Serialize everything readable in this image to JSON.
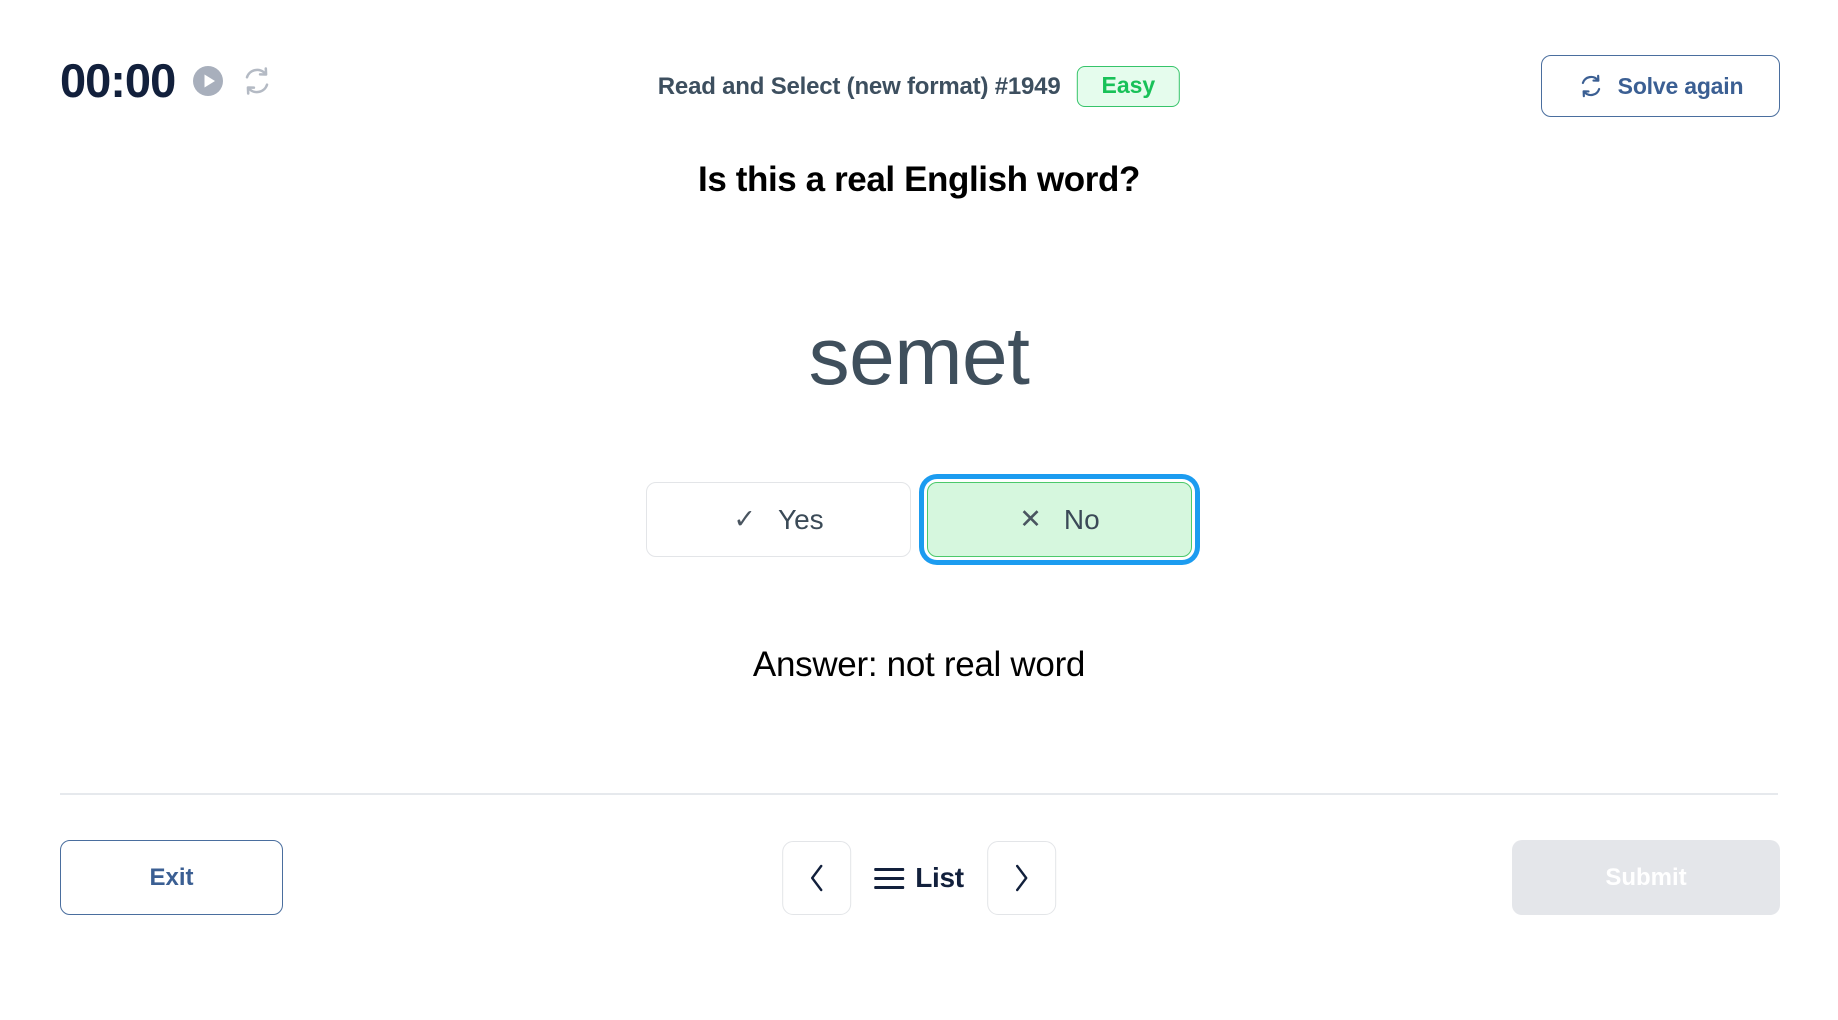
{
  "header": {
    "timer": "00:00",
    "play_icon": "play-circle-icon",
    "reset_icon": "refresh-icon",
    "title": "Read and Select (new format) #1949",
    "difficulty_badge": "Easy",
    "difficulty_color": "#18c158",
    "solve_again_label": "Solve again",
    "solve_again_icon": "refresh-icon",
    "accent_blue": "#3b5f93"
  },
  "main": {
    "question": "Is this a real English word?",
    "word": "semet",
    "choices": [
      {
        "label": "Yes",
        "glyph": "✓",
        "icon": "check-icon",
        "selected": false
      },
      {
        "label": "No",
        "glyph": "✕",
        "icon": "cross-icon",
        "selected": true
      }
    ],
    "answer": "Answer: not real word",
    "selected_highlight_color": "#d6f7de",
    "focus_ring_color": "#1c9cf0"
  },
  "footer": {
    "exit_label": "Exit",
    "prev_icon": "chevron-left-icon",
    "list_icon": "hamburger-menu-icon",
    "list_label": "List",
    "next_icon": "chevron-right-icon",
    "submit_label": "Submit",
    "submit_disabled_color": "#e4e6ea"
  }
}
